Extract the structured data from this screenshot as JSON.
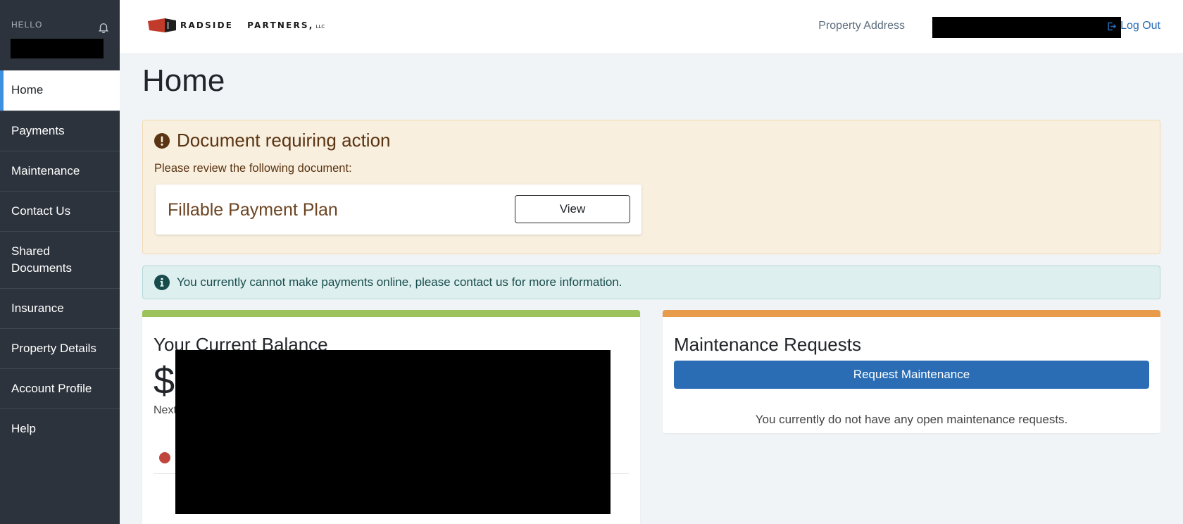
{
  "sidebar": {
    "hello": "HELLO",
    "items": [
      {
        "label": "Home"
      },
      {
        "label": "Payments"
      },
      {
        "label": "Maintenance"
      },
      {
        "label": "Contact Us"
      },
      {
        "label": "Shared\nDocuments"
      },
      {
        "label": "Insurance"
      },
      {
        "label": "Property Details"
      },
      {
        "label": "Account Profile"
      },
      {
        "label": "Help"
      }
    ]
  },
  "header": {
    "logo_word1": "RADSIDE",
    "logo_word2": "PARTNERS,",
    "logo_llc": "LLC",
    "property_label": "Property Address",
    "logout_label": "Log Out"
  },
  "main": {
    "title": "Home",
    "alert": {
      "title": "Document requiring action",
      "subtitle": "Please review the following document:",
      "document_name": "Fillable Payment Plan",
      "view_label": "View"
    },
    "info": "You currently cannot make payments online, please contact us for more information.",
    "balance_card": {
      "title": "Your Current Balance",
      "currency": "$",
      "next_label": "Next"
    },
    "maintenance_card": {
      "title": "Maintenance Requests",
      "button_label": "Request Maintenance",
      "empty_message": "You currently do not have any open maintenance requests."
    }
  },
  "colors": {
    "sidebar_bg": "#2c333c",
    "accent_blue": "#2a6db5",
    "balance_accent": "#9bc25b",
    "maintenance_accent": "#e99b4c",
    "warning_bg": "#f8efde",
    "info_bg": "#deefef"
  }
}
